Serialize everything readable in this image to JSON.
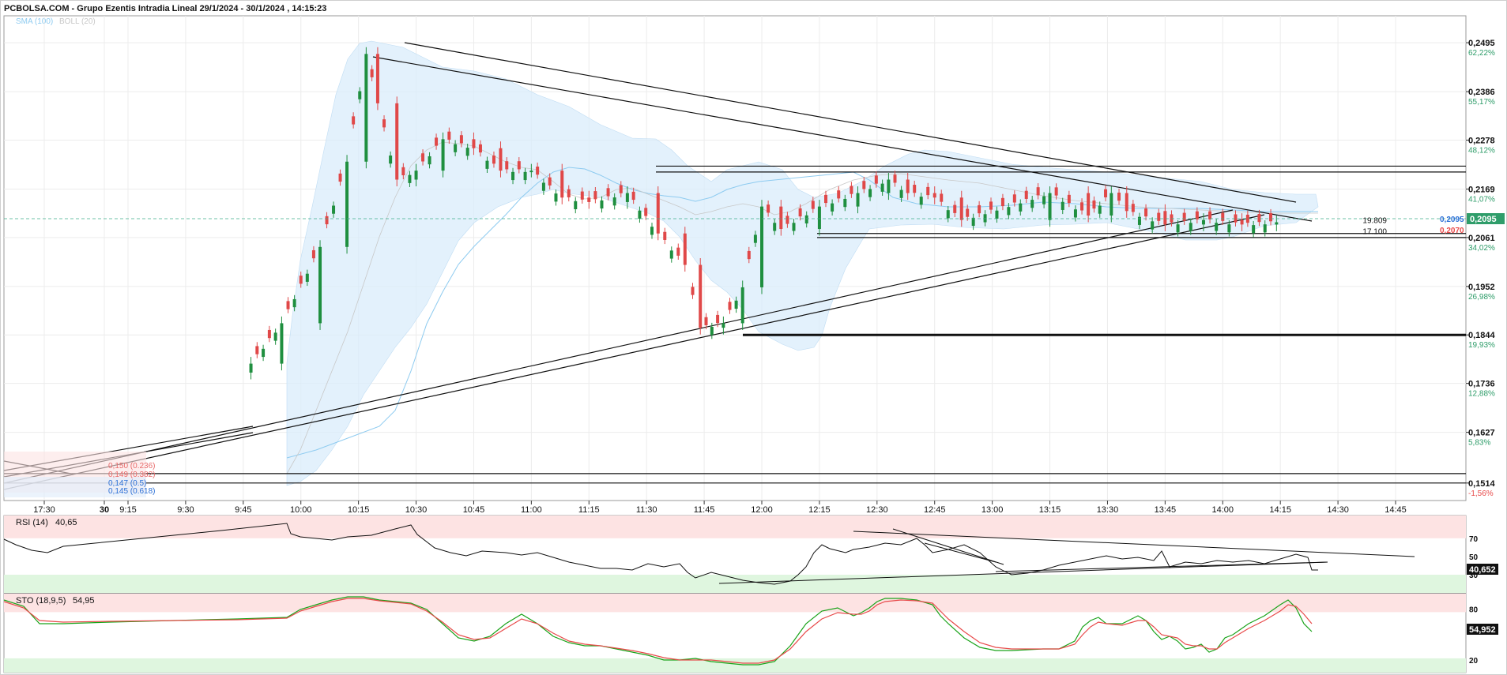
{
  "header": {
    "title": "PCBOLSA.COM - Grupo Ezentis Intradia Lineal 29/1/2024 - 30/1/2024 , 14:15:23",
    "indicators": [
      {
        "label": "SMA (100)",
        "color": "#8ecbf0"
      },
      {
        "label": "BOLL (20)",
        "color": "#c8c8c8"
      }
    ]
  },
  "chart_data": [
    {
      "type": "candlestick",
      "ylim": [
        0.1475,
        0.2555
      ],
      "price_axis": [
        {
          "price": 0.2495,
          "pct": "62,22%"
        },
        {
          "price": 0.2386,
          "pct": "55,17%"
        },
        {
          "price": 0.2278,
          "pct": "48,12%"
        },
        {
          "price": 0.2169,
          "pct": "41,07%"
        },
        {
          "price": 0.2061,
          "pct": "34,02%"
        },
        {
          "price": 0.1952,
          "pct": "26,98%"
        },
        {
          "price": 0.1844,
          "pct": "19,93%"
        },
        {
          "price": 0.1736,
          "pct": "12,88%"
        },
        {
          "price": 0.1627,
          "pct": "5,83%"
        },
        {
          "price": 0.1514,
          "pct": "-1,56%"
        }
      ],
      "time_axis": [
        "17:30",
        "30",
        "9:15",
        "9:30",
        "9:45",
        "10:00",
        "10:15",
        "10:30",
        "10:45",
        "11:00",
        "11:15",
        "11:30",
        "11:45",
        "12:00",
        "12:15",
        "12:30",
        "12:45",
        "13:00",
        "13:15",
        "13:30",
        "13:45",
        "14:00",
        "14:15",
        "14:30",
        "14:45"
      ],
      "last_price": {
        "value": "0,2095",
        "color": "#2f9d6a",
        "label_color": "#2a6fd6"
      },
      "alt_price": {
        "value": "0,2070",
        "color": "#e84a4a"
      },
      "volume_marks": [
        {
          "label": "19.809",
          "price": 0.2095
        },
        {
          "label": "17.100",
          "price": 0.207
        }
      ],
      "fibonacci": [
        {
          "label": "0,150 (0.236)",
          "color": "#e86a6a"
        },
        {
          "label": "0,149 (0.382)",
          "color": "#e86a6a"
        },
        {
          "label": "0,147 (0.5)",
          "color": "#2a6fd6"
        },
        {
          "label": "0,145 (0.618)",
          "color": "#2a6fd6"
        }
      ],
      "close_series": [
        {
          "t": "9:47",
          "v": 0.178
        },
        {
          "t": "9:55",
          "v": 0.187
        },
        {
          "t": "10:05",
          "v": 0.204
        },
        {
          "t": "10:12",
          "v": 0.223
        },
        {
          "t": "10:17",
          "v": 0.247
        },
        {
          "t": "10:20",
          "v": 0.236
        },
        {
          "t": "10:25",
          "v": 0.219
        },
        {
          "t": "10:30",
          "v": 0.221
        },
        {
          "t": "10:37",
          "v": 0.228
        },
        {
          "t": "10:45",
          "v": 0.226
        },
        {
          "t": "10:52",
          "v": 0.221
        },
        {
          "t": "11:00",
          "v": 0.221
        },
        {
          "t": "11:08",
          "v": 0.215
        },
        {
          "t": "11:15",
          "v": 0.214
        },
        {
          "t": "11:25",
          "v": 0.216
        },
        {
          "t": "11:33",
          "v": 0.207
        },
        {
          "t": "11:40",
          "v": 0.2
        },
        {
          "t": "11:44",
          "v": 0.186
        },
        {
          "t": "11:50",
          "v": 0.187
        },
        {
          "t": "11:55",
          "v": 0.195
        },
        {
          "t": "12:00",
          "v": 0.213
        },
        {
          "t": "12:05",
          "v": 0.208
        },
        {
          "t": "12:15",
          "v": 0.213
        },
        {
          "t": "12:25",
          "v": 0.216
        },
        {
          "t": "12:33",
          "v": 0.219
        },
        {
          "t": "12:38",
          "v": 0.216
        },
        {
          "t": "12:45",
          "v": 0.215
        },
        {
          "t": "12:52",
          "v": 0.21
        },
        {
          "t": "13:15",
          "v": 0.216
        },
        {
          "t": "13:25",
          "v": 0.211
        },
        {
          "t": "13:31",
          "v": 0.216
        },
        {
          "t": "13:35",
          "v": 0.212
        },
        {
          "t": "13:45",
          "v": 0.209
        },
        {
          "t": "13:55",
          "v": 0.21
        },
        {
          "t": "14:05",
          "v": 0.209
        },
        {
          "t": "14:14",
          "v": 0.2095
        }
      ],
      "horizontal_levels": [
        0.222,
        0.2207,
        0.207,
        0.2061,
        0.1844,
        0.1535,
        0.1514
      ]
    },
    {
      "type": "line",
      "name": "RSI (14)",
      "value_label": "40,65",
      "last_value": "40,652",
      "levels": [
        70,
        50,
        30
      ],
      "ylim": [
        10,
        95
      ]
    },
    {
      "type": "line",
      "name": "STO (18,9,5)",
      "value_label": "54,95",
      "last_value": "54,952",
      "levels": [
        80,
        50,
        20
      ],
      "ylim": [
        5,
        98
      ]
    }
  ]
}
